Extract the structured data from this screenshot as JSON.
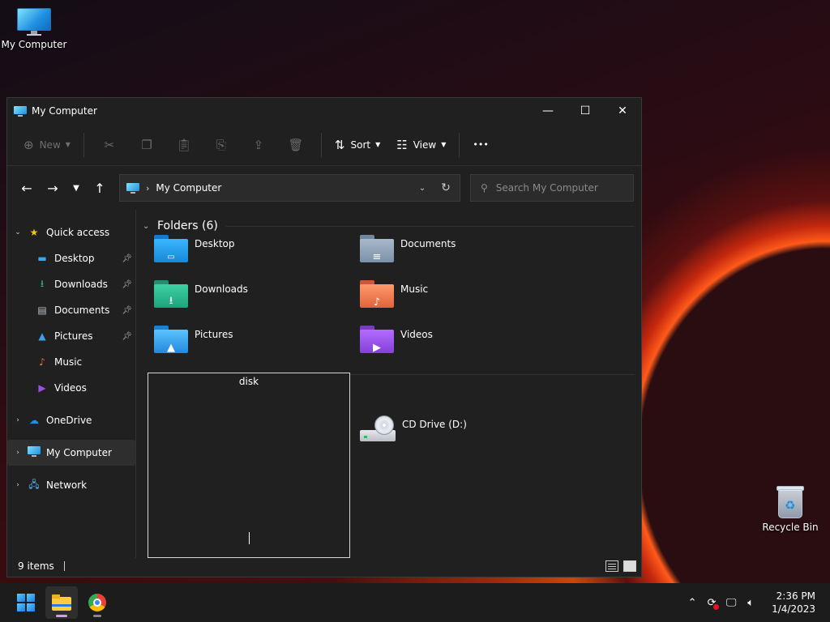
{
  "desktop": {
    "icons": [
      {
        "label": "My Computer",
        "icon": "computer-icon"
      },
      {
        "label": "Recycle Bin",
        "icon": "recycle-bin-icon"
      }
    ]
  },
  "window": {
    "title": "My Computer",
    "controls": {
      "minimize": "—",
      "maximize": "☐",
      "close": "✕"
    }
  },
  "toolbar": {
    "new_label": "New",
    "sort_label": "Sort",
    "view_label": "View",
    "more": "•••"
  },
  "address": {
    "path": "My Computer",
    "search_placeholder": "Search My Computer"
  },
  "nav": {
    "quick_access": "Quick access",
    "quick_items": [
      {
        "label": "Desktop",
        "icon": "desktop-folder-icon",
        "pinned": true
      },
      {
        "label": "Downloads",
        "icon": "downloads-icon",
        "pinned": true
      },
      {
        "label": "Documents",
        "icon": "documents-icon",
        "pinned": true
      },
      {
        "label": "Pictures",
        "icon": "pictures-icon",
        "pinned": true
      },
      {
        "label": "Music",
        "icon": "music-icon",
        "pinned": false
      },
      {
        "label": "Videos",
        "icon": "videos-icon",
        "pinned": false
      }
    ],
    "onedrive": "OneDrive",
    "my_computer": "My Computer",
    "network": "Network"
  },
  "main": {
    "folders_header": "Folders (6)",
    "folders": [
      {
        "label": "Desktop",
        "icon": "desktop-folder-icon",
        "color": "#1e9ae8"
      },
      {
        "label": "Documents",
        "icon": "documents-folder-icon",
        "color": "#8aa0b8"
      },
      {
        "label": "Downloads",
        "icon": "downloads-folder-icon",
        "color": "#2fb38a"
      },
      {
        "label": "Music",
        "icon": "music-folder-icon",
        "color": "#e8734a"
      },
      {
        "label": "Pictures",
        "icon": "pictures-folder-icon",
        "color": "#3aa0ea"
      },
      {
        "label": "Videos",
        "icon": "videos-folder-icon",
        "color": "#9a4fe0"
      }
    ],
    "cd_drive": "CD Drive (D:)"
  },
  "popup": {
    "title": "disk"
  },
  "status": {
    "items": "9 items"
  },
  "taskbar": {
    "time": "2:36 PM",
    "date": "1/4/2023"
  }
}
